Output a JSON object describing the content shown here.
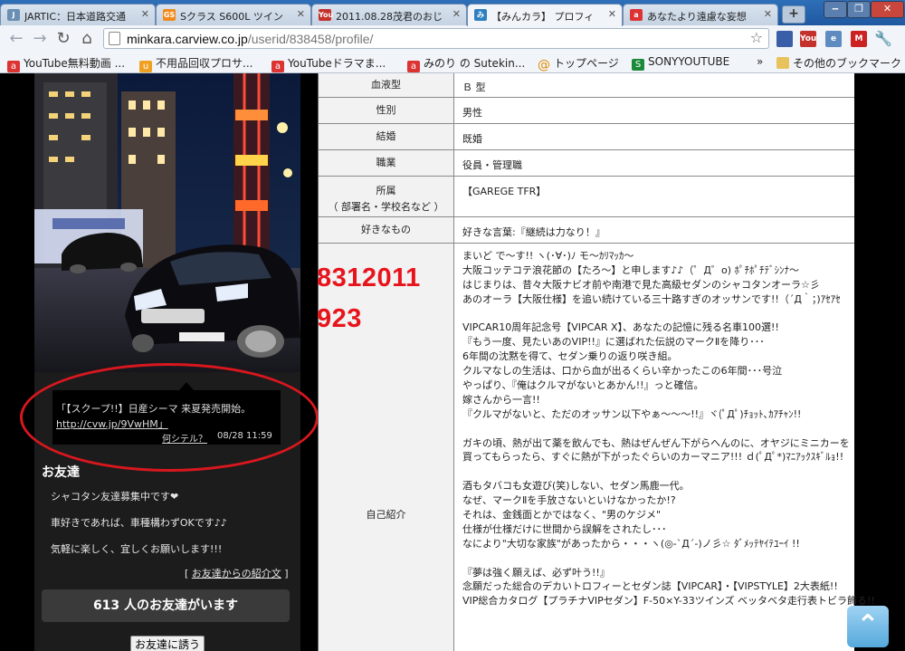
{
  "tabs": [
    {
      "title": "JARTIC：日本道路交通",
      "icon": "jartic-icon",
      "color": "#6a8fb3"
    },
    {
      "title": "Sクラス S600L ツイン",
      "icon": "gs-icon",
      "color": "#f08a1d"
    },
    {
      "title": "2011.08.28茂君のおじ",
      "icon": "youtube-icon",
      "color": "#c4302b"
    },
    {
      "title": "【みんカラ】 プロフィ",
      "icon": "minkara-icon",
      "color": "#2d7fc1"
    },
    {
      "title": "あなたより遠慮な妄想",
      "icon": "ameba-icon",
      "color": "#d33"
    }
  ],
  "toolbar": {
    "url_host": "minkara.carview.co.jp",
    "url_path": "/userid/838458/profile/"
  },
  "bookmarks": [
    {
      "label": "YouTube無料動画 ...",
      "icon": "ameba-icon"
    },
    {
      "label": "不用品回収プロサ...",
      "icon": "bookmark-favicon"
    },
    {
      "label": "YouTubeドラマま...",
      "icon": "ameba-icon"
    },
    {
      "label": "みのり の Sutekin...",
      "icon": "ameba-icon"
    },
    {
      "label": "トップページ",
      "icon": "at-icon"
    },
    {
      "label": "SONYYOUTUBE",
      "icon": "s-icon"
    }
  ],
  "bookmarks_more": "»",
  "bookmarks_other": "その他のブックマーク",
  "sidebar": {
    "tweet_text": "「【スクープ!!】日産シーマ 来夏発売開始。",
    "tweet_link": "http://cvw.jp/9VwHM」",
    "tweet_what": "何シテル？",
    "tweet_time": "08/28 11:59",
    "friends_heading": "お友達",
    "friends_lines": [
      "シャコタン友達募集中です❤",
      "車好きであれば、車種構わずOKです♪♪",
      "気軽に楽しく、宜しくお願いします!!!"
    ],
    "intro_link": "お友達からの紹介文",
    "friend_count": "613 人のお友達がいます",
    "invite": "お友達に誘う"
  },
  "stamp": {
    "line1": "8312011",
    "line2": "923"
  },
  "profile": {
    "rows": [
      {
        "key": "血液型",
        "value": "Ｂ 型"
      },
      {
        "key": "性別",
        "value": "男性"
      },
      {
        "key": "結婚",
        "value": "既婚"
      },
      {
        "key": "職業",
        "value": "役員・管理職"
      },
      {
        "key": "所属",
        "key2": "（ 部署名・学校名など ）",
        "value": "【GAREGE TFR】"
      },
      {
        "key": "好きなもの",
        "value": "好きな言葉:『継続は力なり！』"
      }
    ],
    "intro_key": "自己紹介",
    "intro_lines": [
      "まいど で～す!! ヽ(･∀･)ﾉ モ～ｶﾘﾏｯｶ～",
      "大阪コッテコテ浪花節の【たろ～】と申します♪♪（゜Д゜o) ﾎﾟﾁﾎﾟﾁﾃﾞｼﾝﾅ～",
      "はじまりは、昔々大阪ナビオ前や南港で見た高級セダンのシャコタンオーラ☆彡",
      "あのオーラ【大阪仕様】を追い続けている三十路すぎのオッサンです!!（´Д｀；)ｱｾｱｾ",
      "",
      "VIPCAR10周年記念号【VIPCAR X】、あなたの記憶に残る名車100選!!",
      "『もう一度、見たいあのVIP!!』に選ばれた伝説のマークⅡを降り･･･",
      "6年間の沈黙を得て、セダン乗りの返り咲き組。",
      "クルマなしの生活は、口から血が出るくらい辛かったこの6年間･･･号泣",
      "やっぱり、『俺はクルマがないとあかん!!』っと確信。",
      "嫁さんから一言!!",
      "『クルマがないと、ただのオッサン以下やぁ～～～!!』ヾ(ﾟДﾟ)ﾁｮｯﾄ､ｶｱﾁｬﾝ!!",
      "",
      "ガキの頃、熱が出て薬を飲んでも、熱はぜんぜん下がらへんのに、オヤジにミニカーを",
      "買ってもらったら、すぐに熱が下がったぐらいのカーマニア!!! ｄ(ﾟДﾟ*)ﾏﾆｱｯｸｽｷﾞﾙｮ!!",
      "",
      "酒もタバコも女遊び(笑)しない、セダン馬鹿一代。",
      "なぜ、マークⅡを手放さないといけなかったか!?",
      "それは、金銭面とかではなく、\"男のケジメ\"",
      "仕様が仕様だけに世間から誤解をされたし･･･",
      "なにより\"大切な家族\"があったから・・・ヽ(◎-`Д´-)ノ彡☆ ﾀﾞﾒｯﾃﾔｲﾃﾕｰｲ !!",
      "",
      "『夢は強く願えば、必ず叶う!!』",
      "念願だった総合のデカいトロフィーとセダン誌【VIPCAR】・【VIPSTYLE】2大表紙!!",
      "VIP総合カタログ【プラチナVIPセダン】F-50×Y-33ツインズ ベッタベタ走行表トビラ飾る!!"
    ]
  }
}
